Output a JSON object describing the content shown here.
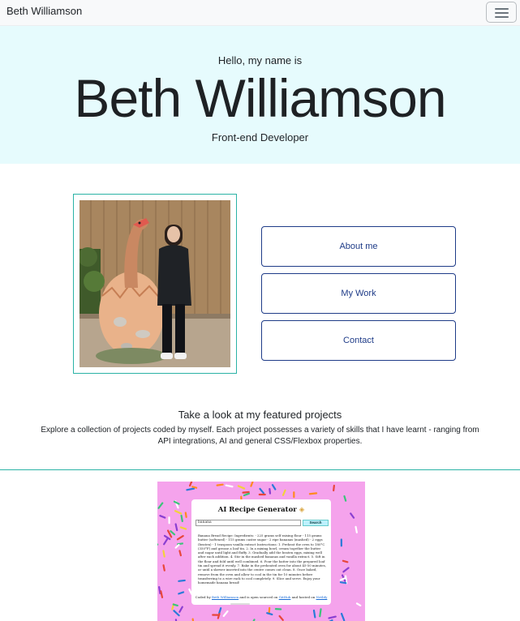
{
  "navbar": {
    "brand": "Beth Williamson",
    "menu_icon": "hamburger-menu-icon"
  },
  "hero": {
    "greeting": "Hello, my name is",
    "name": "Beth Williamson",
    "role": "Front-end Developer",
    "background": "#e6fbfd"
  },
  "profile_photo": {
    "subject": "person standing beside dinosaur hatching from egg statue"
  },
  "nav_buttons": [
    {
      "label": "About me"
    },
    {
      "label": "My Work"
    },
    {
      "label": "Contact"
    }
  ],
  "featured": {
    "title": "Take a look at my featured projects",
    "description": "Explore a collection of projects coded by myself. Each project possesses a variety of skills that I have learnt - ranging from API integrations, AI and general CSS/Flexbox properties."
  },
  "project": {
    "title": "AI Recipe Generator",
    "title_icon": "cupcake-icon",
    "search_value": "banana",
    "search_button": "Search",
    "recipe_text": "Banana Bread Recipe: Ingredients: - 225 grams self raising flour - 115 grams butter (softened) - 115 grams caster sugar - 2 ripe bananas (mashed) - 2 eggs (beaten) - 1 teaspoon vanilla extract Instructions: 1. Preheat the oven to 180°C (350°F) and grease a loaf tin. 2. In a mixing bowl, cream together the butter and sugar until light and fluffy. 3. Gradually add the beaten eggs, mixing well after each addition. 4. Stir in the mashed bananas and vanilla extract. 5. Sift in the flour and fold until well combined. 6. Pour the batter into the prepared loaf tin and spread it evenly. 7. Bake in the preheated oven for about 45-50 minutes, or until a skewer inserted into the centre comes out clean. 8. Once baked, remove from the oven and allow to cool in the tin for 10 minutes before transferring to a wire rack to cool completely. 9. Slice and serve. Enjoy your homemade banana bread!",
    "footer_prefix": "Coded by",
    "footer_author": "Beth Williamson",
    "footer_middle": "and is open sourced on",
    "footer_github": "GitHub",
    "footer_and": "and hosted on",
    "footer_netlify": "Netlify"
  },
  "colors": {
    "accent_teal": "#2bb3a6",
    "button_blue": "#1f3c88",
    "sprinkle_pink": "#f5a3ec"
  }
}
